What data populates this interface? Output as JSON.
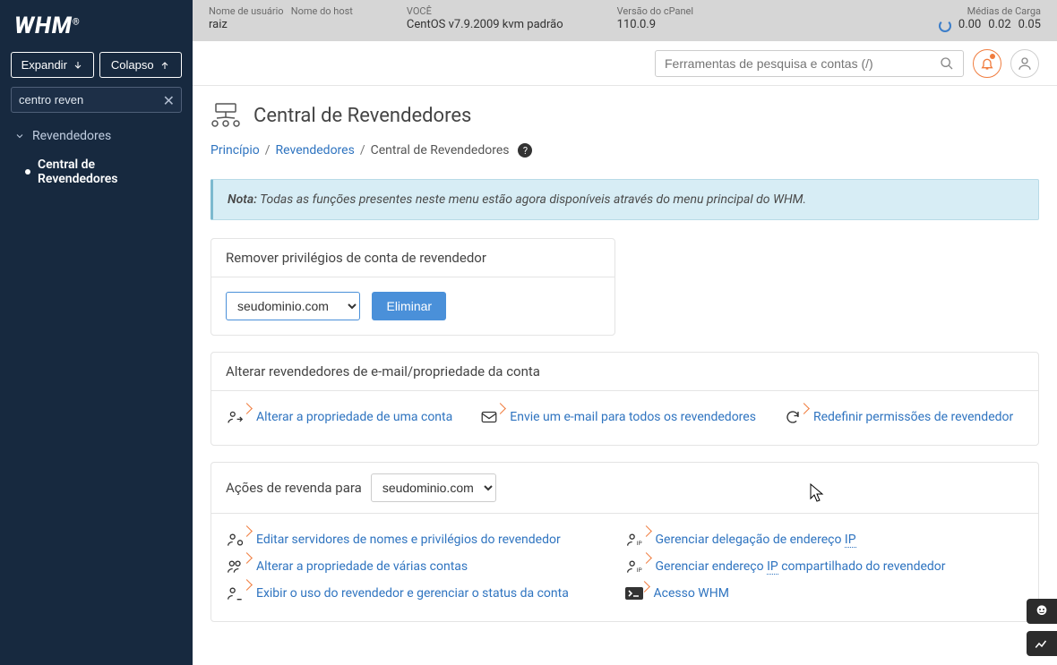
{
  "sidebar": {
    "logo": "WHM",
    "expand": "Expandir",
    "collapse": "Colapso",
    "search_value": "centro reven",
    "group_label": "Revendedores",
    "item_label": "Central de Revendedores"
  },
  "topbar": {
    "user_label": "Nome de usuário",
    "user_value": "raiz",
    "host_label": "Nome do host",
    "os_label": "VOCÊ",
    "os_value": "CentOS v7.9.2009 kvm padrão",
    "ver_label": "Versão do cPanel",
    "ver_value": "110.0.9",
    "load_label": "Médias de Carga",
    "load1": "0.00",
    "load2": "0.02",
    "load3": "0.05"
  },
  "search": {
    "placeholder": "Ferramentas de pesquisa e contas (/)"
  },
  "page": {
    "title": "Central de Revendedores"
  },
  "breadcrumbs": {
    "home": "Princípio",
    "section": "Revendedores",
    "current": "Central de Revendedores"
  },
  "notice": {
    "prefix": "Nota:",
    "text": " Todas as funções presentes neste menu estão agora disponíveis através do menu principal do WHM."
  },
  "remove_panel": {
    "title": "Remover privilégios de conta de revendedor",
    "selected": "seudominio.com",
    "button": "Eliminar"
  },
  "change_panel": {
    "title": "Alterar revendedores de e-mail/propriedade da conta",
    "links": [
      "Alterar a propriedade de uma conta",
      "Envie um e-mail para todos os revendedores",
      "Redefinir permissões de revendedor"
    ]
  },
  "actions_panel": {
    "title_prefix": "Ações de revenda para",
    "selected": "seudominio.com",
    "links_left": [
      "Editar servidores de nomes e privilégios do revendedor",
      "Alterar a propriedade de várias contas",
      "Exibir o uso do revendedor e gerenciar o status da conta"
    ],
    "links_right": [
      {
        "pre": "Gerenciar delegação de endereço ",
        "dotted": "IP"
      },
      {
        "pre": "Gerenciar endereço ",
        "dotted": "IP",
        "post": " compartilhado do revendedor"
      },
      {
        "pre": "Acesso WHM",
        "dotted": "",
        "post": ""
      }
    ]
  }
}
